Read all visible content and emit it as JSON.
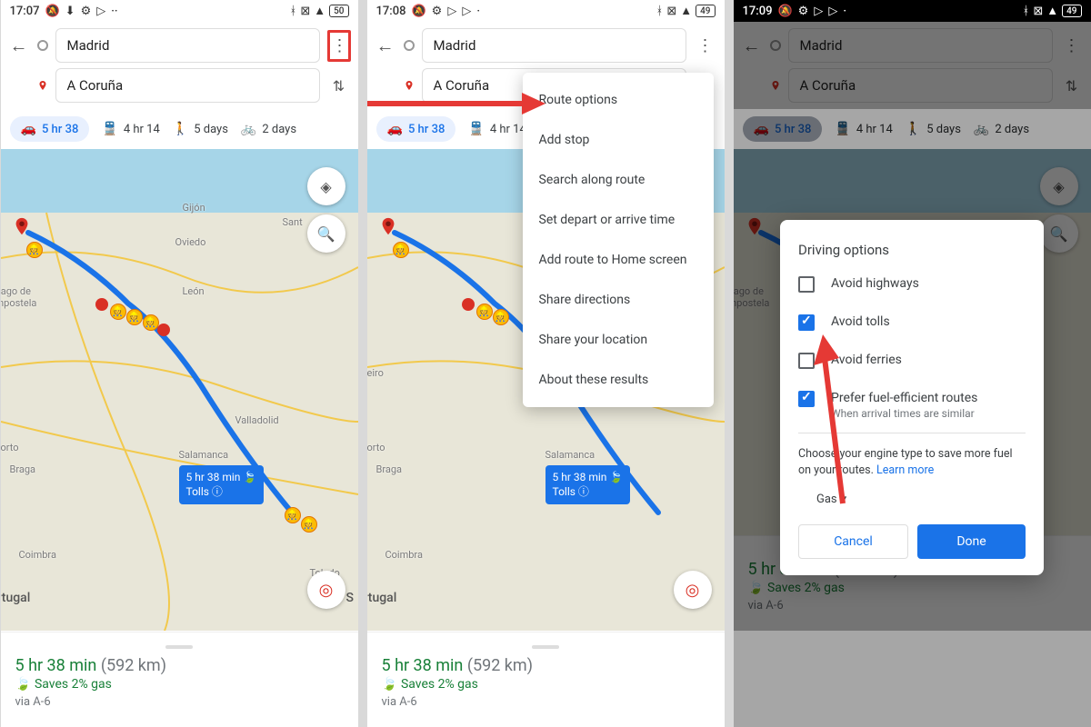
{
  "panel1": {
    "status": {
      "time": "17:07",
      "battery": "50"
    },
    "origin": "Madrid",
    "destination": "A Coruña",
    "modes": {
      "car": "5 hr 38",
      "transit": "4 hr 14",
      "walk": "5 days",
      "bike": "2 days"
    },
    "cities": {
      "gijon": "Gijón",
      "oviedo": "Oviedo",
      "santander": "Sant",
      "santiago": "tiago de\nmpostela",
      "orto": "orto",
      "braga": "Braga",
      "coimbra": "Coimbra",
      "salamanca": "Salamanca",
      "valladolid": "Valladolid",
      "leon": "León",
      "toledo": "Toledo",
      "portugal": "rtugal",
      "spain": "S"
    },
    "route_tip": {
      "line1": "5 hr 38 min 🍃",
      "line2": "Tolls ⓘ"
    },
    "bottom": {
      "time": "5 hr 38 min",
      "distance": "(592 km)",
      "saves": "Saves 2% gas",
      "via": "via A-6"
    }
  },
  "panel2": {
    "status": {
      "time": "17:08",
      "battery": "49"
    },
    "menu": {
      "route_options": "Route options",
      "add_stop": "Add stop",
      "search_along": "Search along route",
      "set_depart": "Set depart or arrive time",
      "add_home": "Add route to Home screen",
      "share_dir": "Share directions",
      "share_loc": "Share your location",
      "about": "About these results"
    }
  },
  "panel3": {
    "status": {
      "time": "17:09",
      "battery": "49"
    },
    "dialog": {
      "title": "Driving options",
      "avoid_highways": "Avoid highways",
      "avoid_tolls": "Avoid tolls",
      "avoid_ferries": "Avoid ferries",
      "prefer_fuel": "Prefer fuel-efficient routes",
      "prefer_fuel_sub": "When arrival times are similar",
      "engine_hint_a": "Choose your engine type to save more fuel on your routes. ",
      "engine_hint_b": "Learn more",
      "engine_value": "Gas",
      "cancel": "Cancel",
      "done": "Done",
      "checked": {
        "highways": false,
        "tolls": true,
        "ferries": false,
        "fuel": true
      }
    }
  }
}
